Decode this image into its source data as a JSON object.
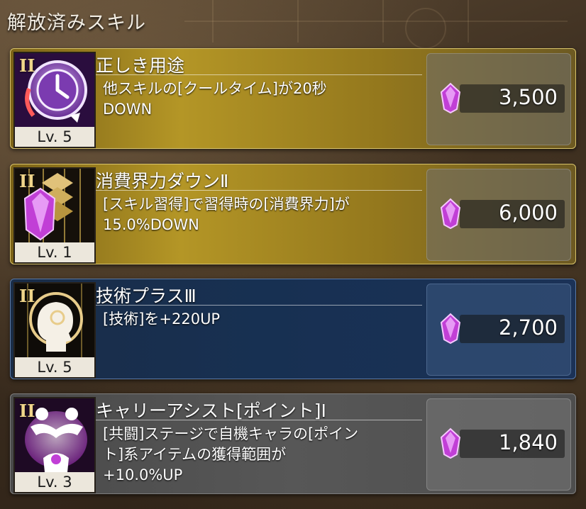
{
  "screen": {
    "title": "解放済みスキル"
  },
  "colors": {
    "gem": "#c13fd6",
    "gold_accent": "#f0d58a"
  },
  "skills": [
    {
      "rank": "II",
      "icon": "clock-icon",
      "level": "Lv. 5",
      "name": "正しき用途",
      "desc_lines": [
        "他スキルの[クールタイム]が20秒",
        "DOWN",
        ""
      ],
      "cost": "3,500"
    },
    {
      "rank": "II",
      "icon": "crystal-down-icon",
      "level": "Lv. 1",
      "name": "消費界力ダウンⅡ",
      "desc_lines": [
        "[スキル習得]で習得時の[消費界力]が",
        "15.0%DOWN",
        ""
      ],
      "cost": "6,000"
    },
    {
      "rank": "II",
      "icon": "head-mind-icon",
      "level": "Lv. 5",
      "name": "技術プラスⅢ",
      "desc_lines": [
        "[技術]を+220UP",
        "",
        ""
      ],
      "cost": "2,700"
    },
    {
      "rank": "II",
      "icon": "assist-buddies-icon",
      "level": "Lv. 3",
      "name": "キャリーアシスト[ポイント]Ⅰ",
      "desc_lines": [
        "[共闘]ステージで自機キャラの[ポイン",
        "ト]系アイテムの獲得範囲が",
        "+10.0%UP"
      ],
      "cost": "1,840"
    }
  ]
}
